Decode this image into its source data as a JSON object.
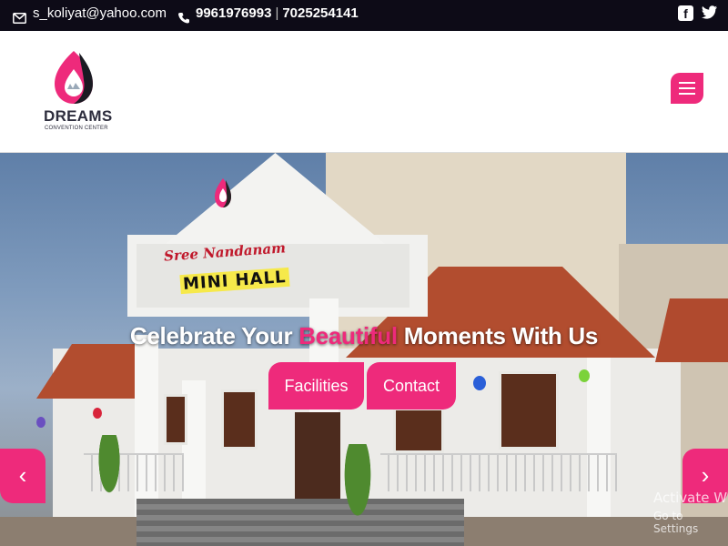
{
  "topbar": {
    "email": "s_koliyat@yahoo.com",
    "phone1": "9961976993",
    "separator": "|",
    "phone2": "7025254141",
    "icons": [
      "envelope-icon",
      "phone-icon",
      "facebook-icon",
      "twitter-icon"
    ]
  },
  "header": {
    "logo_name": "DREAMS",
    "logo_sub": "CONVENTION CENTER",
    "menu_icon": "hamburger-icon"
  },
  "hero": {
    "title_before": "Celebrate Your",
    "title_highlight": "Beautiful",
    "title_after": "Moments With Us",
    "facilities_label": "Facilities",
    "contact_label": "Contact",
    "prev_icon": "‹",
    "next_icon": "›",
    "sign_line1": "Sree Nandanam",
    "sign_line2": "MINI HALL"
  },
  "watermark": {
    "line1": "Activate W",
    "line2": "Go to Settings"
  },
  "colors": {
    "accent": "#ee2a7b",
    "topbar": "#0d0b17",
    "logo_text": "#2d2d3d"
  }
}
